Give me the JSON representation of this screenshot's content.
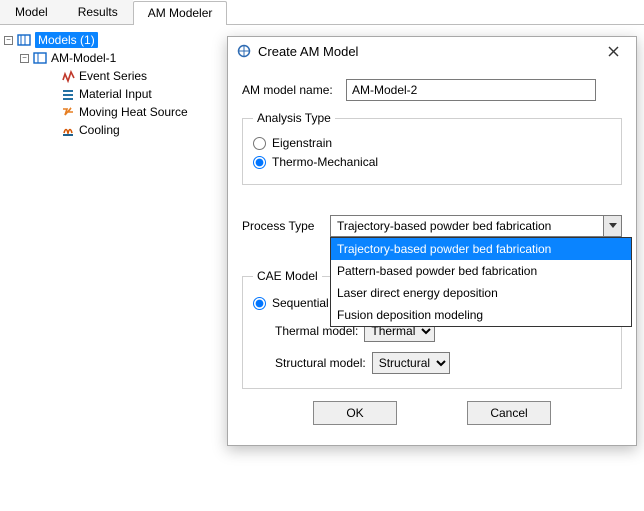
{
  "tabs": [
    "Model",
    "Results",
    "AM Modeler"
  ],
  "active_tab": 2,
  "tree": {
    "root": {
      "label": "Models (1)"
    },
    "am_model": {
      "label": "AM-Model-1"
    },
    "children": {
      "event_series": "Event Series",
      "material_input": "Material Input",
      "moving_heat": "Moving Heat Source",
      "cooling": "Cooling"
    }
  },
  "dialog": {
    "title": "Create AM Model",
    "name_label": "AM model name:",
    "name_value": "AM-Model-2",
    "analysis": {
      "legend": "Analysis Type",
      "eigenstrain": "Eigenstrain",
      "thermo": "Thermo-Mechanical"
    },
    "ptype": {
      "label": "Process Type",
      "value": "Trajectory-based powder bed fabrication",
      "options": [
        "Trajectory-based powder bed fabrication",
        "Pattern-based powder bed fabrication",
        "Laser direct energy deposition",
        "Fusion deposition modeling"
      ]
    },
    "cae": {
      "legend": "CAE Model",
      "sequential": "Sequential",
      "thermal_label": "Thermal  model:",
      "thermal_value": "Thermal",
      "structural_label": "Structural model:",
      "structural_value": "Structural"
    },
    "buttons": {
      "ok": "OK",
      "cancel": "Cancel"
    }
  }
}
